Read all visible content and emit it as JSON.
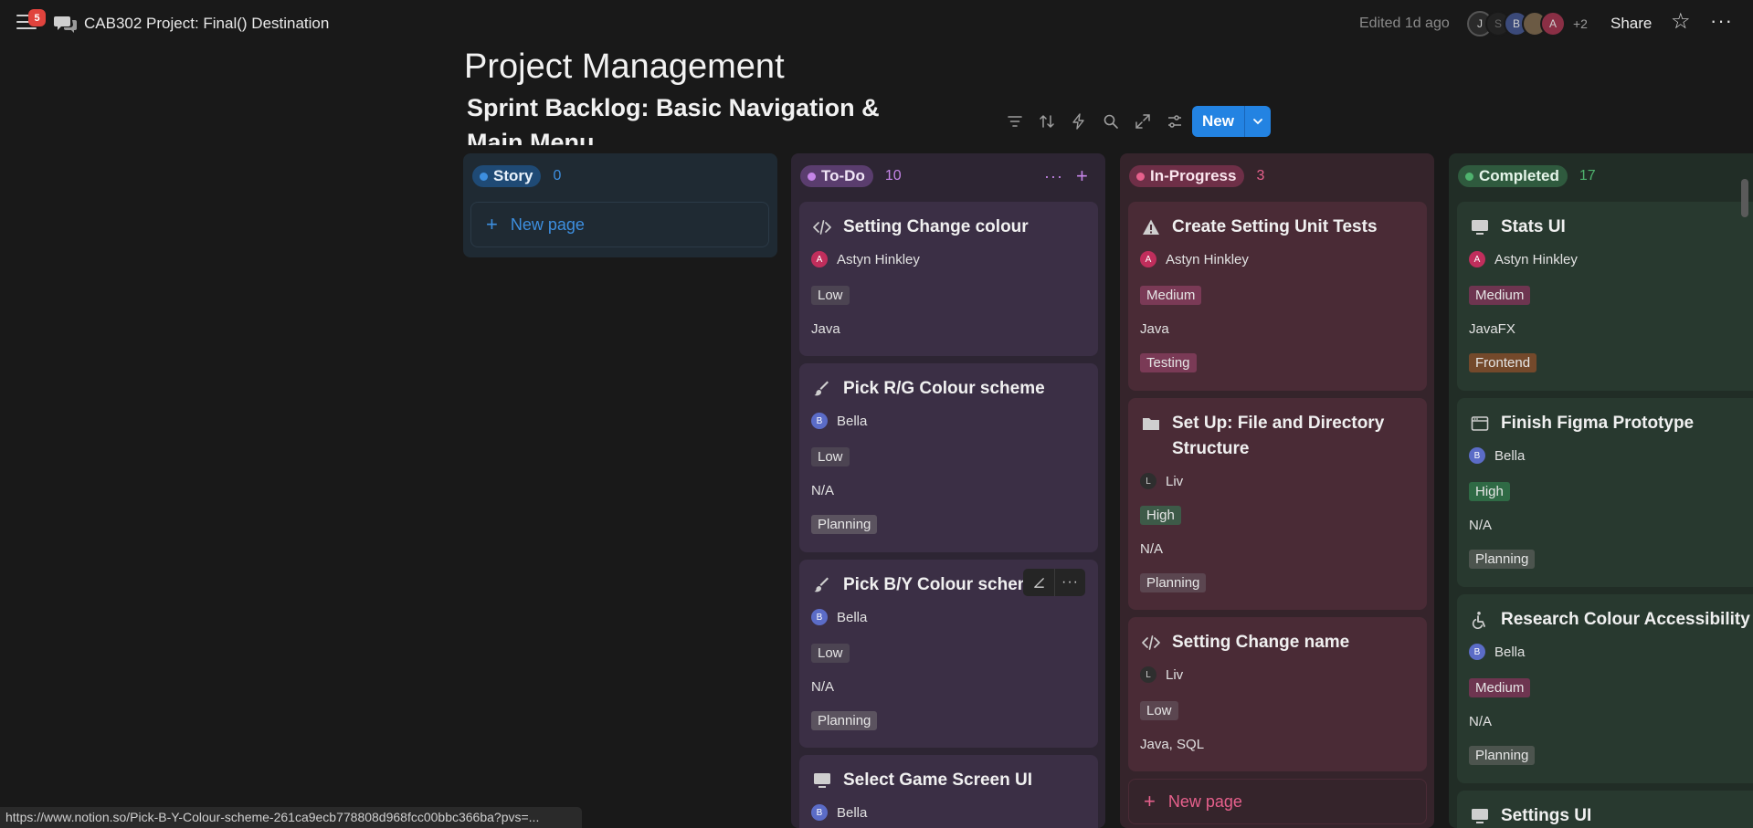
{
  "topbar": {
    "notification_count": "5",
    "title": "CAB302 Project: Final() Destination",
    "edited": "Edited 1d ago",
    "avatars": [
      "J",
      "S",
      "B",
      "",
      "A"
    ],
    "more_avatars": "+2",
    "share_label": "Share"
  },
  "database_title": "Project Management",
  "view_title": "Sprint Backlog: Basic Navigation & Main Menu",
  "toolbar": {
    "icons": [
      "filter-icon",
      "sort-icon",
      "automation-icon",
      "search-icon",
      "expand-icon",
      "settings-icon"
    ],
    "new_label": "New"
  },
  "colors": {
    "accent": "#2383e2",
    "story": "#1f2a33",
    "todo": "#2d2533",
    "in_progress": "#35242b",
    "completed": "#212d26"
  },
  "board": {
    "story": {
      "label": "Story",
      "count": "0",
      "new_page": "New page"
    },
    "todo": {
      "label": "To-Do",
      "count": "10",
      "cards": [
        {
          "icon": "code-icon",
          "title": "Setting Change colour",
          "assignee": "Astyn Hinkley",
          "initial": "A",
          "priority": "Low",
          "language": "Java",
          "tag": ""
        },
        {
          "icon": "brush-icon",
          "title": "Pick R/G Colour scheme",
          "assignee": "Bella",
          "initial": "B",
          "priority": "Low",
          "language": "N/A",
          "tag": "Planning"
        },
        {
          "icon": "brush-icon",
          "title": "Pick B/Y Colour scheme",
          "assignee": "Bella",
          "initial": "B",
          "priority": "Low",
          "language": "N/A",
          "tag": "Planning"
        },
        {
          "icon": "monitor-icon",
          "title": "Select Game Screen UI",
          "assignee": "Bella",
          "initial": "B"
        }
      ]
    },
    "in_progress": {
      "label": "In-Progress",
      "count": "3",
      "new_page": "New page",
      "cards": [
        {
          "icon": "warning-icon",
          "title": "Create Setting Unit Tests",
          "assignee": "Astyn Hinkley",
          "initial": "A",
          "priority": "Medium",
          "language": "Java",
          "tag": "Testing"
        },
        {
          "icon": "folder-icon",
          "title_line1": "Set Up: File and Directory",
          "title_line2": "Structure",
          "assignee": "Liv",
          "initial": "L",
          "priority": "High",
          "language": "N/A",
          "tag": "Planning"
        },
        {
          "icon": "code-icon",
          "title": "Setting Change name",
          "assignee": "Liv",
          "initial": "L",
          "priority": "Low",
          "language": "Java, SQL"
        }
      ]
    },
    "completed": {
      "label": "Completed",
      "count": "17",
      "cards": [
        {
          "icon": "monitor-icon",
          "title": "Stats UI",
          "assignee": "Astyn Hinkley",
          "initial": "A",
          "priority": "Medium",
          "language": "JavaFX",
          "tag": "Frontend"
        },
        {
          "icon": "browser-icon",
          "title": "Finish Figma Prototype",
          "assignee": "Bella",
          "initial": "B",
          "priority": "High",
          "language": "N/A",
          "tag": "Planning"
        },
        {
          "icon": "accessibility-icon",
          "title": "Research Colour Accessibility",
          "assignee": "Bella",
          "initial": "B",
          "priority": "Medium",
          "language": "N/A",
          "tag": "Planning"
        },
        {
          "icon": "monitor-icon",
          "title": "Settings UI"
        }
      ]
    }
  },
  "status_url": "https://www.notion.so/Pick-B-Y-Colour-scheme-261ca9ecb778808d968fcc00bbc366ba?pvs=..."
}
